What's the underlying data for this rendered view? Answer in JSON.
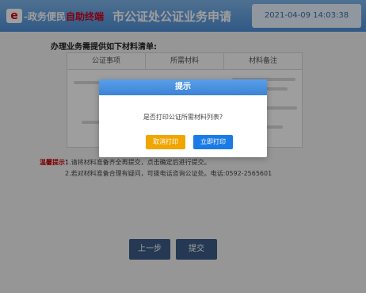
{
  "header": {
    "logo_badge": "e",
    "logo_text_prefix": "-政务便民",
    "logo_text_suffix": "自助终端",
    "title": "市公证处公证业务申请",
    "datetime": "2021-04-09 14:03:38"
  },
  "main": {
    "section_title": "办理业务需提供如下材料清单:",
    "table_headers": [
      "公证事项",
      "所需材料",
      "材料备注"
    ],
    "notes_label": "温馨提示：",
    "notes": [
      "1.请将材料准备齐全再提交，点击确定后进行提交。",
      "2.若对材料准备合理有疑问，可拨电话咨询公证处。电话:0592-2565601"
    ]
  },
  "footer": {
    "prev_label": "上一步",
    "submit_label": "提交"
  },
  "dialog": {
    "title": "提示",
    "message": "是否打印公证所需材料列表?",
    "cancel_label": "取消打印",
    "confirm_label": "立即打印"
  },
  "colors": {
    "header_top": "#7fb6ea",
    "header_bottom": "#4f90d8",
    "bottom_button": "#3c5d88",
    "cancel_button": "#f0a500",
    "confirm_button": "#1a7be6",
    "warning_text": "#c60000"
  }
}
